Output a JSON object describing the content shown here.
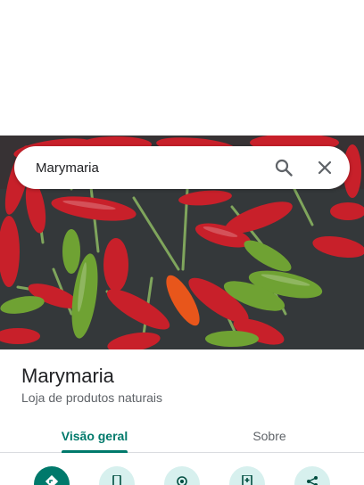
{
  "search": {
    "query": "Marymaria"
  },
  "hero": {
    "image": "photo of red and green chili peppers"
  },
  "place": {
    "name": "Marymaria",
    "category": "Loja de produtos naturais"
  },
  "tabs": [
    {
      "label": "Visão geral",
      "selected": true
    },
    {
      "label": "Sobre",
      "selected": false
    }
  ],
  "actions": [
    {
      "icon": "directions-icon"
    },
    {
      "icon": "phone-icon"
    },
    {
      "icon": "location-icon"
    },
    {
      "icon": "save-icon"
    },
    {
      "icon": "share-icon"
    }
  ],
  "colors": {
    "accent": "#00796b",
    "accent_light": "#d7f0ee",
    "text_primary": "#202124",
    "text_secondary": "#5f6368"
  }
}
